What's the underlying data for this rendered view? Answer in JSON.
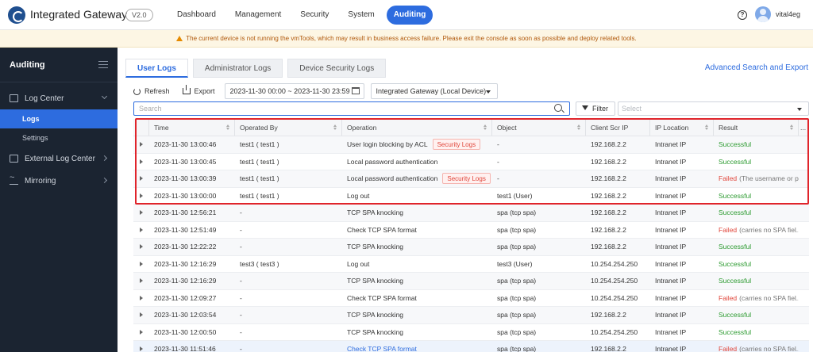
{
  "app": {
    "title": "Integrated Gateway",
    "version": "V2.0"
  },
  "nav": [
    "Dashboard",
    "Management",
    "Security",
    "System",
    "Auditing"
  ],
  "user": {
    "name": "vital4eg"
  },
  "warning": "The current device is not running the vmTools, which may result in business access failure. Please exit the console as soon as possible and deploy related tools.",
  "sidebar": {
    "title": "Auditing",
    "log_center": "Log Center",
    "logs": "Logs",
    "settings": "Settings",
    "external": "External Log Center",
    "mirroring": "Mirroring"
  },
  "tabs": [
    "User Logs",
    "Administrator Logs",
    "Device Security Logs"
  ],
  "advanced_search": "Advanced Search and Export",
  "toolbar": {
    "refresh": "Refresh",
    "export": "Export",
    "date_range": "2023-11-30 00:00 ~ 2023-11-30 23:59",
    "device": "Integrated Gateway (Local Device)"
  },
  "search": {
    "placeholder": "Search",
    "filter": "Filter",
    "select_placeholder": "Select"
  },
  "columns": [
    "Time",
    "Operated By",
    "Operation",
    "Object",
    "Client Scr IP",
    "IP Location",
    "Result"
  ],
  "more": "...",
  "security_tag": "Security Logs",
  "rows": [
    {
      "time": "2023-11-30 13:00:46",
      "by": "test1 ( test1 )",
      "operation": "User login blocking by ACL",
      "object": "-",
      "ip": "192.168.2.2",
      "loc": "Intranet IP",
      "result": "Successful",
      "detail": ""
    },
    {
      "time": "2023-11-30 13:00:45",
      "by": "test1 ( test1 )",
      "operation": "Local password authentication",
      "object": "-",
      "ip": "192.168.2.2",
      "loc": "Intranet IP",
      "result": "Successful",
      "detail": ""
    },
    {
      "time": "2023-11-30 13:00:39",
      "by": "test1 ( test1 )",
      "operation": "Local password authentication",
      "object": "-",
      "ip": "192.168.2.2",
      "loc": "Intranet IP",
      "result": "Failed",
      "detail": "(The username or p..."
    },
    {
      "time": "2023-11-30 13:00:00",
      "by": "test1 ( test1 )",
      "operation": "Log out",
      "object": "test1 (User)",
      "ip": "192.168.2.2",
      "loc": "Intranet IP",
      "result": "Successful",
      "detail": ""
    },
    {
      "time": "2023-11-30 12:56:21",
      "by": "-",
      "operation": "TCP SPA knocking",
      "object": "spa (tcp spa)",
      "ip": "192.168.2.2",
      "loc": "Intranet IP",
      "result": "Successful",
      "detail": ""
    },
    {
      "time": "2023-11-30 12:51:49",
      "by": "-",
      "operation": "Check TCP SPA format",
      "object": "spa (tcp spa)",
      "ip": "192.168.2.2",
      "loc": "Intranet IP",
      "result": "Failed",
      "detail": "(carries no SPA fiel..."
    },
    {
      "time": "2023-11-30 12:22:22",
      "by": "-",
      "operation": "TCP SPA knocking",
      "object": "spa (tcp spa)",
      "ip": "192.168.2.2",
      "loc": "Intranet IP",
      "result": "Successful",
      "detail": ""
    },
    {
      "time": "2023-11-30 12:16:29",
      "by": "test3 ( test3 )",
      "operation": "Log out",
      "object": "test3 (User)",
      "ip": "10.254.254.250",
      "loc": "Intranet IP",
      "result": "Successful",
      "detail": ""
    },
    {
      "time": "2023-11-30 12:16:29",
      "by": "-",
      "operation": "TCP SPA knocking",
      "object": "spa (tcp spa)",
      "ip": "10.254.254.250",
      "loc": "Intranet IP",
      "result": "Successful",
      "detail": ""
    },
    {
      "time": "2023-11-30 12:09:27",
      "by": "-",
      "operation": "Check TCP SPA format",
      "object": "spa (tcp spa)",
      "ip": "10.254.254.250",
      "loc": "Intranet IP",
      "result": "Failed",
      "detail": "(carries no SPA fiel..."
    },
    {
      "time": "2023-11-30 12:03:54",
      "by": "-",
      "operation": "TCP SPA knocking",
      "object": "spa (tcp spa)",
      "ip": "192.168.2.2",
      "loc": "Intranet IP",
      "result": "Successful",
      "detail": ""
    },
    {
      "time": "2023-11-30 12:00:50",
      "by": "-",
      "operation": "TCP SPA knocking",
      "object": "spa (tcp spa)",
      "ip": "10.254.254.250",
      "loc": "Intranet IP",
      "result": "Successful",
      "detail": ""
    },
    {
      "time": "2023-11-30 11:51:46",
      "by": "-",
      "operation": "Check TCP SPA format",
      "object": "spa (tcp spa)",
      "ip": "192.168.2.2",
      "loc": "Intranet IP",
      "result": "Failed",
      "detail": "(carries no SPA fiel..."
    }
  ]
}
